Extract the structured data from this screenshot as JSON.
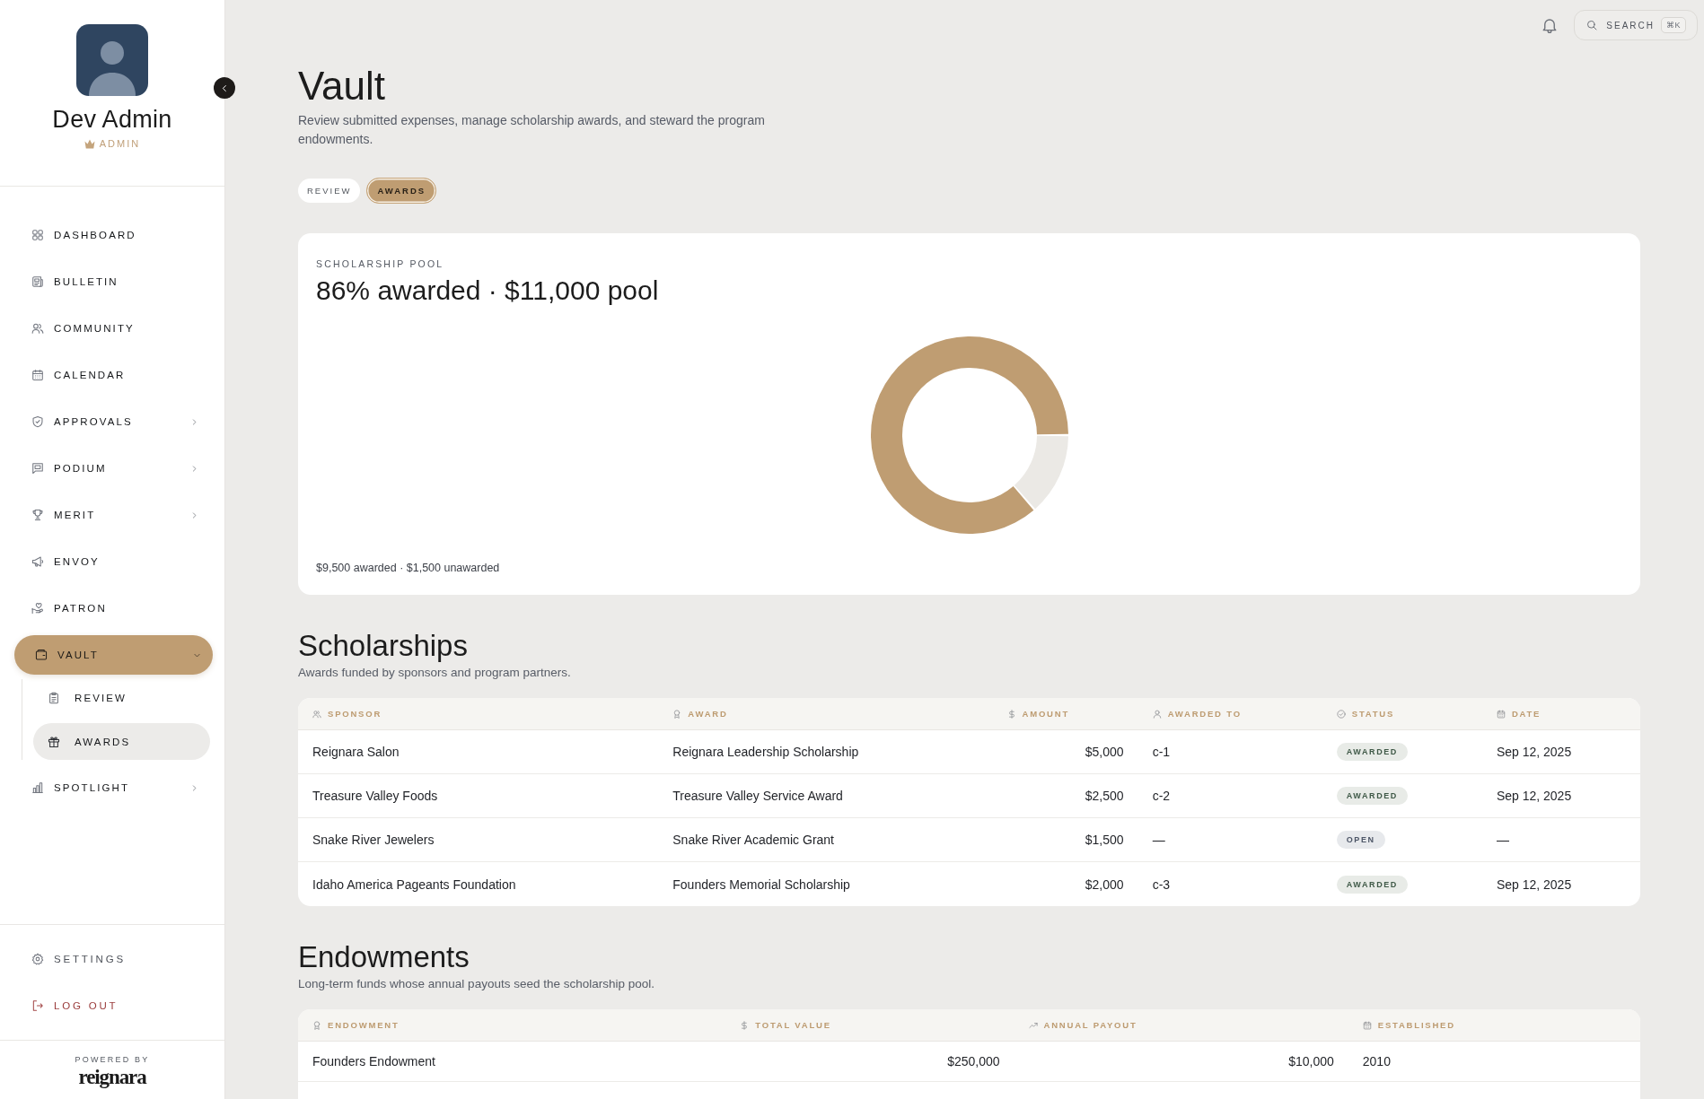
{
  "sidebar": {
    "profile": {
      "name": "Dev Admin",
      "role": "ADMIN"
    },
    "nav_items": [
      {
        "label": "DASHBOARD",
        "kind": "link",
        "selected": false
      },
      {
        "label": "BULLETIN",
        "kind": "link",
        "selected": false
      },
      {
        "label": "COMMUNITY",
        "kind": "link",
        "selected": false
      },
      {
        "label": "CALENDAR",
        "kind": "link",
        "selected": false
      },
      {
        "label": "APPROVALS",
        "kind": "group",
        "selected": false,
        "expanded": false
      },
      {
        "label": "PODIUM",
        "kind": "group",
        "selected": false,
        "expanded": false
      },
      {
        "label": "MERIT",
        "kind": "group",
        "selected": false,
        "expanded": false
      },
      {
        "label": "ENVOY",
        "kind": "link",
        "selected": false
      },
      {
        "label": "PATRON",
        "kind": "link",
        "selected": false
      },
      {
        "label": "VAULT",
        "kind": "group",
        "selected": true,
        "expanded": true,
        "children": [
          {
            "label": "REVIEW",
            "selected": false
          },
          {
            "label": "AWARDS",
            "selected": true
          }
        ]
      },
      {
        "label": "SPOTLIGHT",
        "kind": "group",
        "selected": false,
        "expanded": false
      }
    ],
    "footer_items": [
      {
        "label": "SETTINGS",
        "kind": "link"
      },
      {
        "label": "LOG OUT",
        "kind": "logout"
      }
    ],
    "powered_by": {
      "label": "POWERED BY",
      "brand": "reignara"
    }
  },
  "header": {
    "search": {
      "label": "SEARCH",
      "shortcut": "⌘K"
    }
  },
  "page": {
    "title": "Vault",
    "description": "Review submitted expenses, manage scholarship awards, and steward the program endowments.",
    "tabs": [
      {
        "label": "REVIEW",
        "selected": false
      },
      {
        "label": "AWARDS",
        "selected": true
      }
    ]
  },
  "pool_card": {
    "eyebrow": "SCHOLARSHIP POOL",
    "headline": "86% awarded · $11,000 pool",
    "chart_data": {
      "type": "donut",
      "values": [
        86.4,
        13.6
      ]
    },
    "caption": "$9,500 awarded · $1,500 unawarded"
  },
  "scholarships": {
    "title": "Scholarships",
    "subtitle": "Awards funded by sponsors and program partners.",
    "columns": [
      "SPONSOR",
      "AWARD",
      "AMOUNT",
      "AWARDED TO",
      "STATUS",
      "DATE"
    ],
    "rows": [
      {
        "sponsor": "Reignara Salon",
        "award": "Reignara Leadership Scholarship",
        "amount": "$5,000",
        "awarded_to": "c-1",
        "status": {
          "label": "AWARDED",
          "kind": "awarded"
        },
        "date": "Sep 12, 2025"
      },
      {
        "sponsor": "Treasure Valley Foods",
        "award": "Treasure Valley Service Award",
        "amount": "$2,500",
        "awarded_to": "c-2",
        "status": {
          "label": "AWARDED",
          "kind": "awarded"
        },
        "date": "Sep 12, 2025"
      },
      {
        "sponsor": "Snake River Jewelers",
        "award": "Snake River Academic Grant",
        "amount": "$1,500",
        "awarded_to": "—",
        "status": {
          "label": "OPEN",
          "kind": "open"
        },
        "date": "—"
      },
      {
        "sponsor": "Idaho America Pageants Foundation",
        "award": "Founders Memorial Scholarship",
        "amount": "$2,000",
        "awarded_to": "c-3",
        "status": {
          "label": "AWARDED",
          "kind": "awarded"
        },
        "date": "Sep 12, 2025"
      }
    ]
  },
  "endowments": {
    "title": "Endowments",
    "subtitle": "Long-term funds whose annual payouts seed the scholarship pool.",
    "columns": [
      "ENDOWMENT",
      "TOTAL VALUE",
      "ANNUAL PAYOUT",
      "ESTABLISHED"
    ],
    "rows": [
      {
        "endowment": "Founders Endowment",
        "total_value": "$250,000",
        "annual_payout": "$10,000",
        "established": "2010"
      }
    ]
  }
}
